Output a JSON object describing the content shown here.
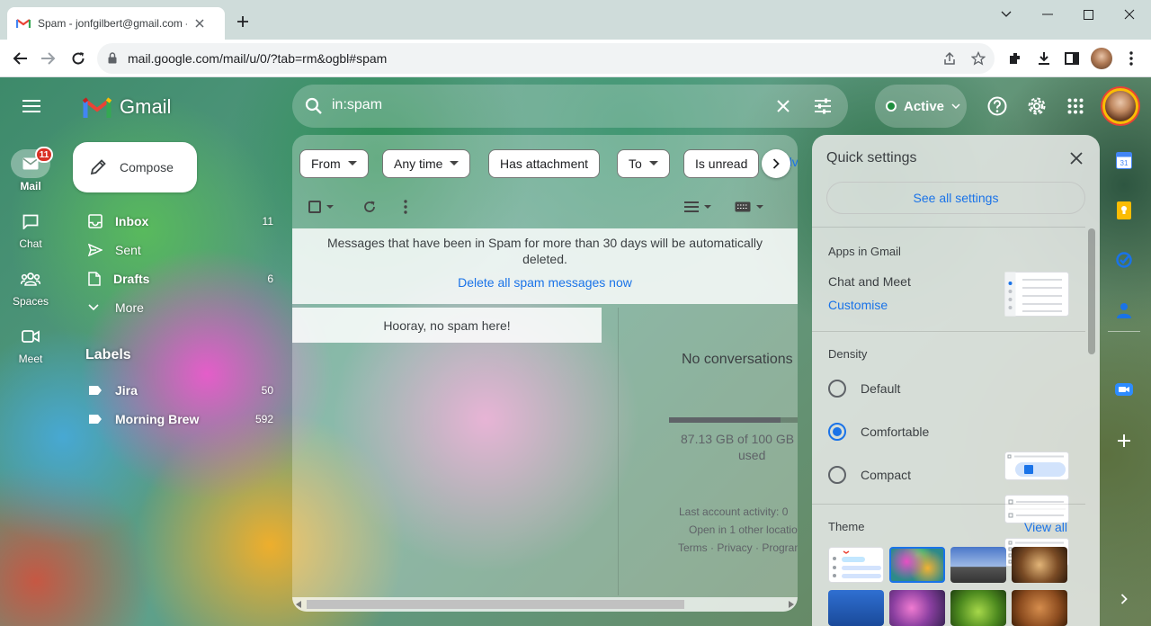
{
  "browser": {
    "tab_title": "Spam - jonfgilbert@gmail.com -",
    "url": "mail.google.com/mail/u/0/?tab=rm&ogbl#spam"
  },
  "app": {
    "brand": "Gmail",
    "search_query": "in:spam",
    "status": "Active",
    "rail": [
      {
        "label": "Mail",
        "badge": "11"
      },
      {
        "label": "Chat"
      },
      {
        "label": "Spaces"
      },
      {
        "label": "Meet"
      }
    ]
  },
  "nav": {
    "compose": "Compose",
    "items": [
      {
        "label": "Inbox",
        "count": "11"
      },
      {
        "label": "Sent",
        "count": ""
      },
      {
        "label": "Drafts",
        "count": "6"
      },
      {
        "label": "More",
        "count": ""
      }
    ],
    "labels_heading": "Labels",
    "labels": [
      {
        "label": "Jira",
        "count": "50"
      },
      {
        "label": "Morning Brew",
        "count": "592"
      }
    ]
  },
  "filters": {
    "chips": [
      "From",
      "Any time",
      "Has attachment",
      "To",
      "Is unread"
    ],
    "overflow_text": "dv"
  },
  "spam": {
    "notice": "Messages that have been in Spam for more than 30 days will be automatically deleted.",
    "delete_link": "Delete all spam messages now",
    "empty": "Hooray, no spam here!"
  },
  "reading": {
    "no_conversations": "No conversations",
    "storage_line1": "87.13 GB of 100 GB (8",
    "storage_line2": "used",
    "storage_fraction": 0.87,
    "activity": "Last account activity: 0 ",
    "open_in": "Open in 1 other locatio",
    "footer": "Terms · Privacy · Program"
  },
  "quick_settings": {
    "title": "Quick settings",
    "see_all": "See all settings",
    "apps_heading": "Apps in Gmail",
    "chat_meet": "Chat and Meet",
    "customise": "Customise",
    "density_heading": "Density",
    "density_options": [
      {
        "label": "Default",
        "selected": false
      },
      {
        "label": "Comfortable",
        "selected": true
      },
      {
        "label": "Compact",
        "selected": false
      }
    ],
    "theme_heading": "Theme",
    "view_all": "View all"
  },
  "colors": {
    "accent_blue": "#1a73e8",
    "badge_red": "#d93025",
    "status_green": "#1e8e3e"
  }
}
